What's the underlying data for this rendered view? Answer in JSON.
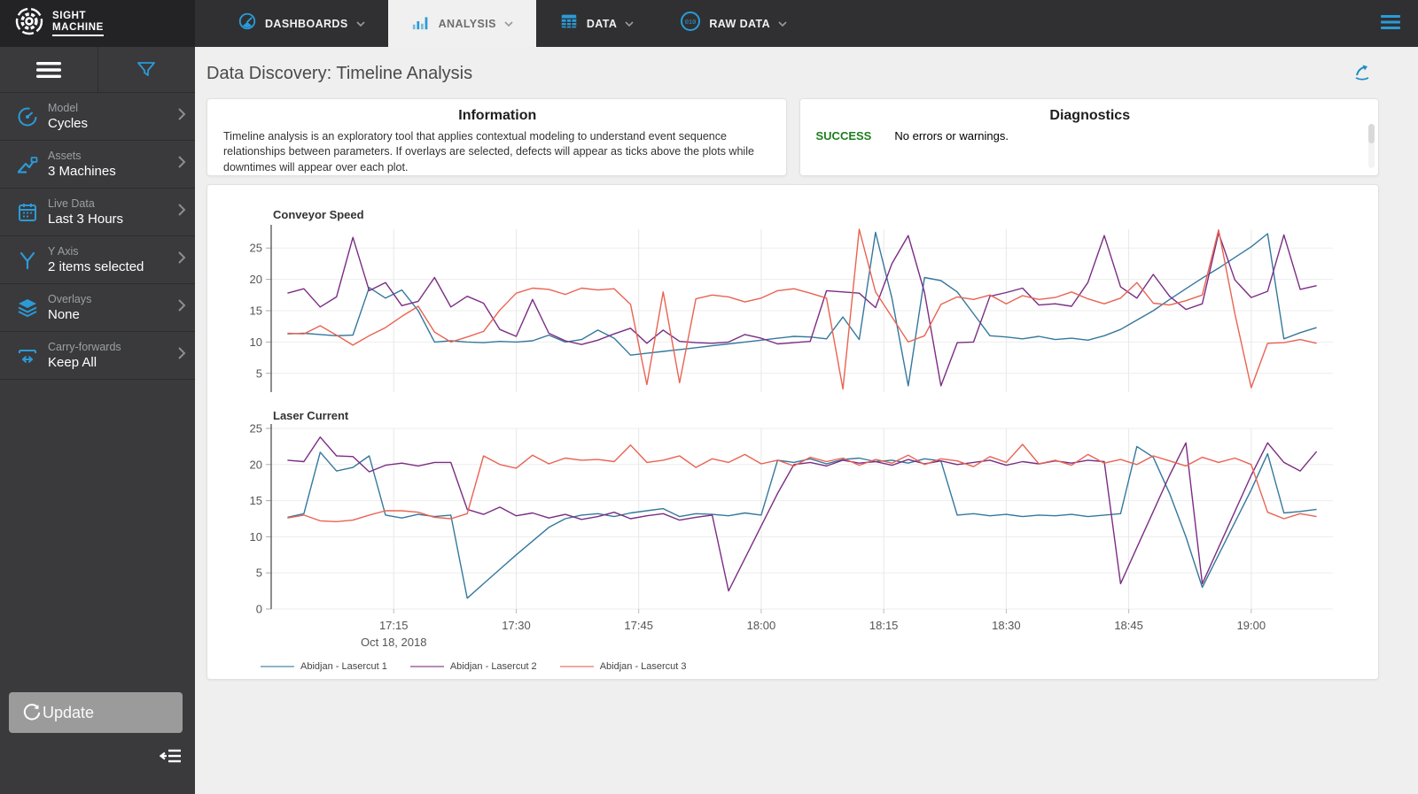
{
  "colors": {
    "accent_blue": "#2b9bd7",
    "success_green": "#1d7f1d",
    "series_blue": "#34789c",
    "series_purple": "#7b2d83",
    "series_salmon": "#e96352"
  },
  "nav": {
    "logo_line1": "SIGHT",
    "logo_line2": "MACHINE",
    "items": [
      {
        "label": "DASHBOARDS",
        "active": false
      },
      {
        "label": "ANALYSIS",
        "active": true
      },
      {
        "label": "DATA",
        "active": false
      },
      {
        "label": "RAW DATA",
        "active": false
      }
    ],
    "raw_data_glyph": "010"
  },
  "sidebar": {
    "items": [
      {
        "label": "Model",
        "value": "Cycles"
      },
      {
        "label": "Assets",
        "value": "3 Machines"
      },
      {
        "label": "Live Data",
        "value": "Last 3 Hours"
      },
      {
        "label": "Y Axis",
        "value": "2 items selected"
      },
      {
        "label": "Overlays",
        "value": "None"
      },
      {
        "label": "Carry-forwards",
        "value": "Keep All"
      }
    ],
    "update_label": "Update"
  },
  "header": {
    "title": "Data Discovery: Timeline Analysis"
  },
  "info_panel": {
    "title": "Information",
    "body": "Timeline analysis is an exploratory tool that applies contextual modeling to understand event sequence relationships between parameters. If overlays are selected, defects will appear as ticks above the plots while downtimes will appear over each plot."
  },
  "diagnostics_panel": {
    "title": "Diagnostics",
    "status": "SUCCESS",
    "message": "No errors or warnings."
  },
  "chart_data": [
    {
      "type": "line",
      "title": "Conveyor Speed",
      "ylim": [
        2,
        28
      ],
      "y_ticks": [
        5,
        10,
        15,
        20,
        25
      ],
      "x_ticks": [
        "17:15",
        "17:30",
        "17:45",
        "18:00",
        "18:15",
        "18:30",
        "18:45",
        "19:00"
      ],
      "x_date_label": "Oct 18, 2018",
      "x": [
        "17:02",
        "17:04",
        "17:06",
        "17:08",
        "17:10",
        "17:12",
        "17:14",
        "17:16",
        "17:18",
        "17:20",
        "17:22",
        "17:24",
        "17:26",
        "17:28",
        "17:30",
        "17:32",
        "17:34",
        "17:36",
        "17:38",
        "17:40",
        "17:42",
        "17:44",
        "17:46",
        "17:48",
        "17:50",
        "17:52",
        "17:54",
        "17:56",
        "17:58",
        "18:00",
        "18:02",
        "18:04",
        "18:06",
        "18:08",
        "18:10",
        "18:12",
        "18:14",
        "18:16",
        "18:18",
        "18:20",
        "18:22",
        "18:24",
        "18:26",
        "18:28",
        "18:30",
        "18:32",
        "18:34",
        "18:36",
        "18:38",
        "18:40",
        "18:42",
        "18:44",
        "18:46",
        "18:48",
        "18:50",
        "18:52",
        "18:54",
        "18:56",
        "18:58",
        "19:00",
        "19:02",
        "19:04",
        "19:06",
        "19:08"
      ],
      "series": [
        {
          "name": "Abidjan - Lasercut 1",
          "color": "#34789c",
          "values": [
            11.3,
            11.4,
            11.2,
            11.0,
            11.1,
            18.7,
            17.0,
            18.3,
            15.0,
            10.0,
            10.2,
            10.0,
            9.9,
            10.1,
            10.0,
            10.2,
            11.1,
            10.0,
            10.4,
            11.9,
            10.6,
            7.9,
            8.2,
            8.5,
            8.8,
            9.1,
            9.4,
            9.7,
            10.0,
            10.3,
            10.6,
            10.9,
            10.8,
            10.5,
            14.0,
            10.4,
            27.5,
            17.0,
            3.0,
            20.3,
            19.8,
            18.0,
            14.5,
            11.0,
            10.8,
            10.5,
            10.9,
            10.4,
            10.6,
            10.3,
            11.0,
            12.0,
            13.5,
            15.0,
            16.8,
            18.5,
            20.2,
            21.8,
            23.5,
            25.2,
            27.3,
            10.5,
            11.5,
            12.3
          ]
        },
        {
          "name": "Abidjan - Lasercut 2",
          "color": "#7b2d83",
          "values": [
            17.8,
            18.5,
            15.6,
            17.2,
            26.7,
            18.2,
            19.5,
            15.8,
            16.5,
            20.3,
            15.6,
            17.3,
            16.2,
            12.0,
            10.9,
            16.8,
            11.4,
            10.2,
            9.6,
            10.3,
            11.3,
            12.2,
            9.8,
            11.9,
            10.1,
            9.9,
            9.8,
            10.0,
            11.2,
            10.6,
            9.7,
            9.9,
            10.1,
            18.2,
            18.0,
            17.8,
            15.5,
            22.5,
            27.0,
            17.9,
            3.0,
            9.9,
            10.0,
            17.3,
            17.9,
            18.6,
            15.9,
            16.1,
            15.7,
            19.5,
            27.0,
            18.8,
            17.0,
            20.8,
            17.3,
            15.2,
            16.1,
            27.4,
            19.9,
            17.1,
            18.1,
            27.1,
            18.4,
            19.0
          ]
        },
        {
          "name": "Abidjan - Lasercut 3",
          "color": "#e96352",
          "values": [
            11.4,
            11.3,
            12.6,
            11.1,
            9.5,
            11.0,
            12.3,
            14.1,
            15.7,
            11.6,
            10.0,
            10.8,
            11.7,
            15.1,
            17.8,
            18.6,
            18.4,
            17.6,
            18.6,
            18.3,
            18.5,
            16.0,
            3.2,
            18.0,
            3.5,
            16.9,
            17.5,
            17.2,
            16.4,
            17.0,
            18.2,
            18.5,
            17.8,
            17.0,
            2.5,
            28.0,
            18.0,
            14.0,
            10.0,
            11.0,
            16.0,
            17.2,
            16.8,
            17.5,
            16.1,
            17.4,
            16.8,
            17.1,
            18.0,
            16.9,
            16.1,
            17.0,
            19.5,
            16.2,
            15.9,
            16.6,
            17.5,
            27.9,
            14.5,
            2.7,
            9.8,
            9.9,
            10.4,
            9.8
          ]
        }
      ]
    },
    {
      "type": "line",
      "title": "Laser Current",
      "ylim": [
        0,
        25
      ],
      "y_ticks": [
        0,
        5,
        10,
        15,
        20,
        25
      ],
      "x_ticks": [
        "17:15",
        "17:30",
        "17:45",
        "18:00",
        "18:15",
        "18:30",
        "18:45",
        "19:00"
      ],
      "x_date_label": "Oct 18, 2018",
      "x": [
        "17:02",
        "17:04",
        "17:06",
        "17:08",
        "17:10",
        "17:12",
        "17:14",
        "17:16",
        "17:18",
        "17:20",
        "17:22",
        "17:24",
        "17:26",
        "17:28",
        "17:30",
        "17:32",
        "17:34",
        "17:36",
        "17:38",
        "17:40",
        "17:42",
        "17:44",
        "17:46",
        "17:48",
        "17:50",
        "17:52",
        "17:54",
        "17:56",
        "17:58",
        "18:00",
        "18:02",
        "18:04",
        "18:06",
        "18:08",
        "18:10",
        "18:12",
        "18:14",
        "18:16",
        "18:18",
        "18:20",
        "18:22",
        "18:24",
        "18:26",
        "18:28",
        "18:30",
        "18:32",
        "18:34",
        "18:36",
        "18:38",
        "18:40",
        "18:42",
        "18:44",
        "18:46",
        "18:48",
        "18:50",
        "18:52",
        "18:54",
        "18:56",
        "18:58",
        "19:00",
        "19:02",
        "19:04",
        "19:06",
        "19:08"
      ],
      "series": [
        {
          "name": "Abidjan - Lasercut 1",
          "color": "#34789c",
          "values": [
            12.7,
            13.2,
            21.7,
            19.1,
            19.6,
            21.2,
            13.0,
            12.6,
            13.1,
            12.8,
            13.0,
            1.5,
            3.5,
            5.5,
            7.5,
            9.4,
            11.3,
            12.5,
            13.0,
            13.2,
            12.8,
            13.3,
            13.6,
            13.9,
            12.8,
            13.2,
            13.1,
            12.9,
            13.3,
            13.0,
            20.6,
            20.3,
            20.8,
            20.1,
            20.7,
            20.9,
            20.4,
            20.6,
            20.2,
            20.8,
            20.5,
            13.0,
            13.2,
            12.9,
            13.1,
            12.8,
            13.0,
            12.9,
            13.1,
            12.8,
            13.0,
            13.2,
            22.5,
            21.0,
            16.0,
            10.0,
            3.0,
            7.5,
            12.0,
            16.5,
            21.5,
            13.3,
            13.5,
            13.8
          ]
        },
        {
          "name": "Abidjan - Lasercut 2",
          "color": "#7b2d83",
          "values": [
            20.6,
            20.4,
            23.8,
            21.2,
            21.1,
            19.0,
            19.9,
            20.2,
            19.8,
            20.3,
            20.3,
            13.8,
            13.1,
            14.1,
            12.9,
            13.3,
            12.6,
            13.1,
            12.4,
            12.8,
            13.4,
            12.5,
            12.9,
            13.2,
            12.3,
            12.7,
            13.0,
            2.5,
            7.0,
            11.5,
            16.0,
            20.0,
            20.3,
            19.8,
            20.6,
            20.2,
            20.4,
            19.9,
            20.7,
            20.1,
            20.5,
            20.0,
            20.3,
            20.6,
            19.9,
            20.4,
            20.1,
            20.5,
            20.2,
            20.6,
            20.4,
            3.5,
            8.5,
            13.5,
            18.5,
            23.0,
            3.5,
            8.5,
            13.5,
            18.5,
            23.0,
            20.3,
            19.1,
            21.8
          ]
        },
        {
          "name": "Abidjan - Lasercut 3",
          "color": "#e96352",
          "values": [
            12.6,
            13.0,
            12.2,
            12.1,
            12.3,
            13.0,
            13.6,
            13.6,
            13.4,
            12.7,
            12.5,
            13.2,
            21.2,
            20.0,
            19.5,
            21.3,
            20.1,
            20.9,
            20.6,
            20.7,
            20.4,
            22.7,
            20.3,
            20.6,
            21.2,
            19.6,
            20.8,
            20.3,
            21.4,
            20.1,
            20.6,
            19.8,
            21.0,
            20.4,
            20.9,
            19.9,
            20.7,
            20.2,
            21.3,
            20.0,
            20.8,
            20.5,
            19.7,
            21.1,
            20.3,
            22.8,
            20.1,
            20.6,
            19.9,
            21.4,
            20.2,
            20.7,
            20.0,
            21.2,
            20.5,
            19.8,
            21.0,
            20.3,
            20.9,
            20.0,
            13.4,
            12.5,
            13.2,
            12.8
          ]
        }
      ]
    }
  ]
}
